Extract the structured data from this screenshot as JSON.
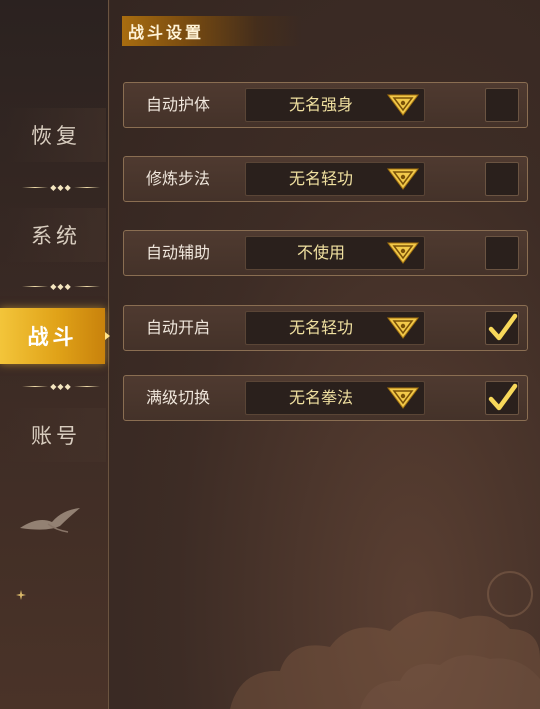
{
  "sidebar": {
    "items": [
      {
        "label": "恢复",
        "active": false
      },
      {
        "label": "系统",
        "active": false
      },
      {
        "label": "战斗",
        "active": true
      },
      {
        "label": "账号",
        "active": false
      }
    ]
  },
  "header": {
    "title": "战斗设置"
  },
  "settings": [
    {
      "label": "自动护体",
      "value": "无名强身",
      "checked": false
    },
    {
      "label": "修炼步法",
      "value": "无名轻功",
      "checked": false
    },
    {
      "label": "自动辅助",
      "value": "不使用",
      "checked": false
    },
    {
      "label": "自动开启",
      "value": "无名轻功",
      "checked": true
    },
    {
      "label": "满级切换",
      "value": "无名拳法",
      "checked": true
    }
  ],
  "colors": {
    "accent": "#e0a218",
    "check": "#f7d85a",
    "select_text": "#f0e0a0"
  },
  "icons": {
    "dropdown": "dropdown-arrow-icon",
    "check": "check-icon"
  }
}
